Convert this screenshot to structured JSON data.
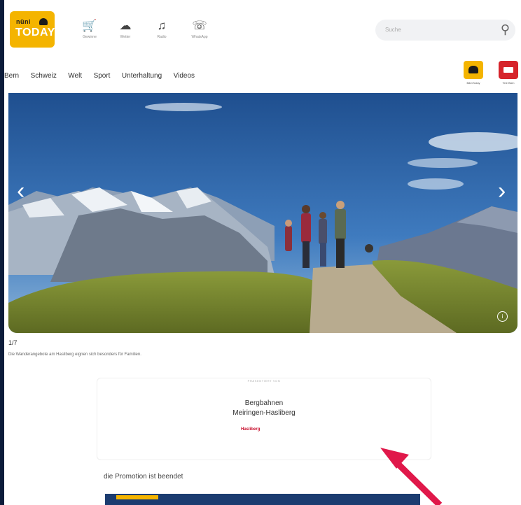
{
  "header": {
    "logo_top": "nüni",
    "logo_brand": "TODAY",
    "icons": [
      {
        "name": "cart-icon",
        "glyph": "🛒",
        "label": "Gewinne"
      },
      {
        "name": "cloud-icon",
        "glyph": "☁",
        "label": "Wetter"
      },
      {
        "name": "music-icon",
        "glyph": "♫",
        "label": "Radio"
      },
      {
        "name": "whatsapp-icon",
        "glyph": "☏",
        "label": "WhatsApp"
      }
    ],
    "search_placeholder": "Suche",
    "search_icon": "search-icon"
  },
  "nav": {
    "items": [
      "Bern",
      "Schweiz",
      "Welt",
      "Sport",
      "Unterhaltung",
      "Videos"
    ],
    "badge1_label": "BärnToday",
    "badge2_label": "Tele Bärn"
  },
  "gallery": {
    "counter": "1/7",
    "caption": "Die Wanderangebote am Hasliberg eignen sich besonders für Familien.",
    "prev_icon": "chevron-left-icon",
    "next_icon": "chevron-right-icon",
    "info_icon": "info-icon"
  },
  "promo": {
    "presented_by": "PRÄSENTIERT VON",
    "line1": "Bergbahnen",
    "line2": "Meiringen-Hasliberg",
    "sublogo": "Hasliberg"
  },
  "promotion_status": "die Promotion ist beendet",
  "colors": {
    "brand_yellow": "#f4b400",
    "accent_red": "#e0184a",
    "badge_red": "#d6242b"
  }
}
